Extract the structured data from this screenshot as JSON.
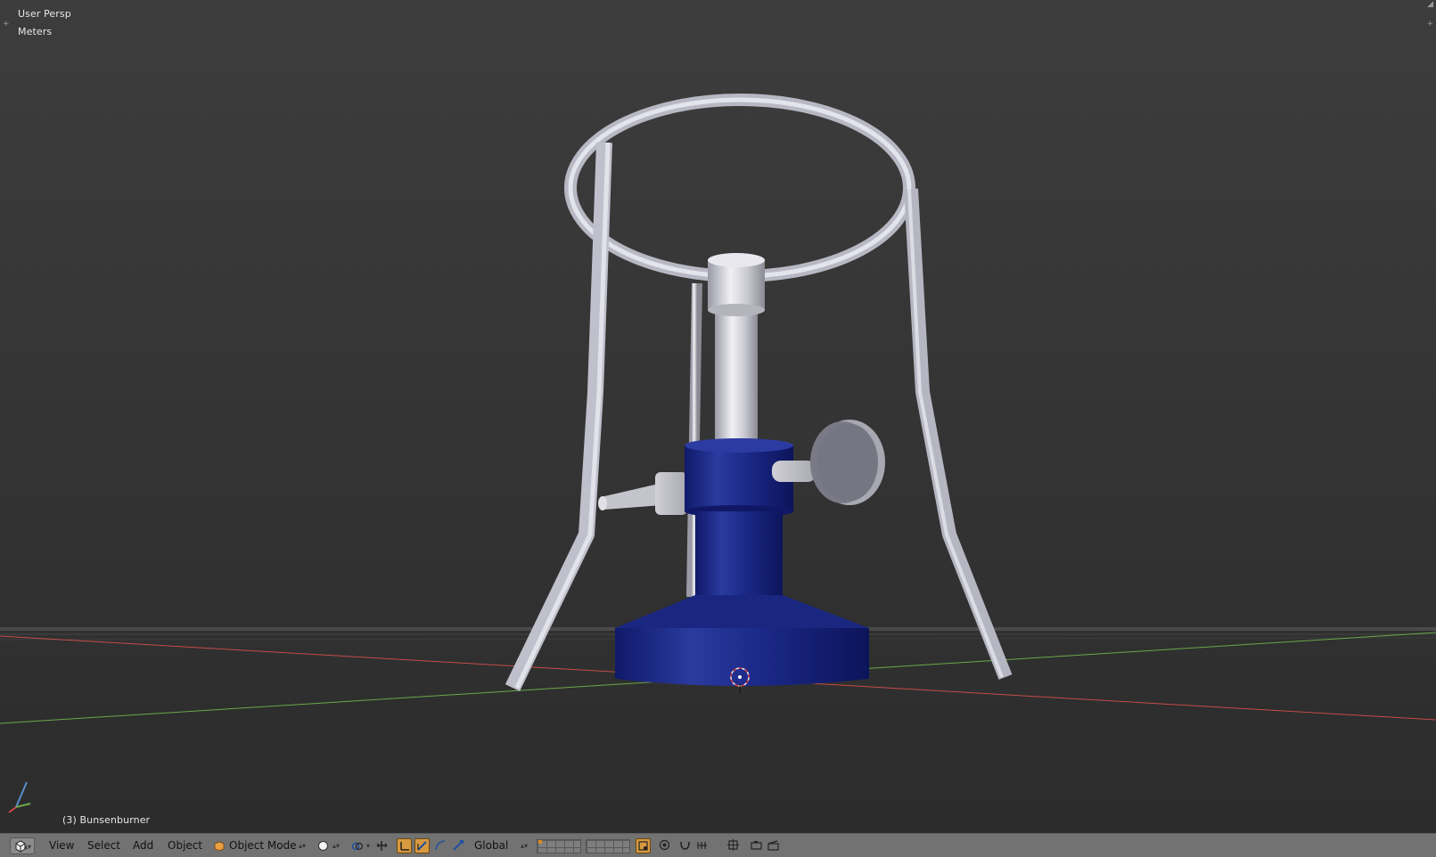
{
  "viewport": {
    "view_name": "User Persp",
    "units": "Meters",
    "active_object": "(3) Bunsenburner"
  },
  "header": {
    "menus": [
      "View",
      "Select",
      "Add",
      "Object"
    ],
    "mode": "Object Mode",
    "transform_orientation": "Global"
  },
  "colors": {
    "viewport_bg": "#353535",
    "header_bg": "#727272",
    "burner_blue": "#1c2a8a",
    "steel": "#c8c8d2",
    "x_axis": "#c84a4a",
    "y_axis": "#6aa84a"
  },
  "icons": {
    "editor_type": "view3d-icon",
    "mode": "object-cube-icon",
    "shading": "solid-sphere-icon",
    "pivot": "pivot-icon",
    "manipulator": "manipulator-icon",
    "orientation": "transform-orientation-icon",
    "snap": "magnet-icon",
    "render": "camera-icon"
  }
}
